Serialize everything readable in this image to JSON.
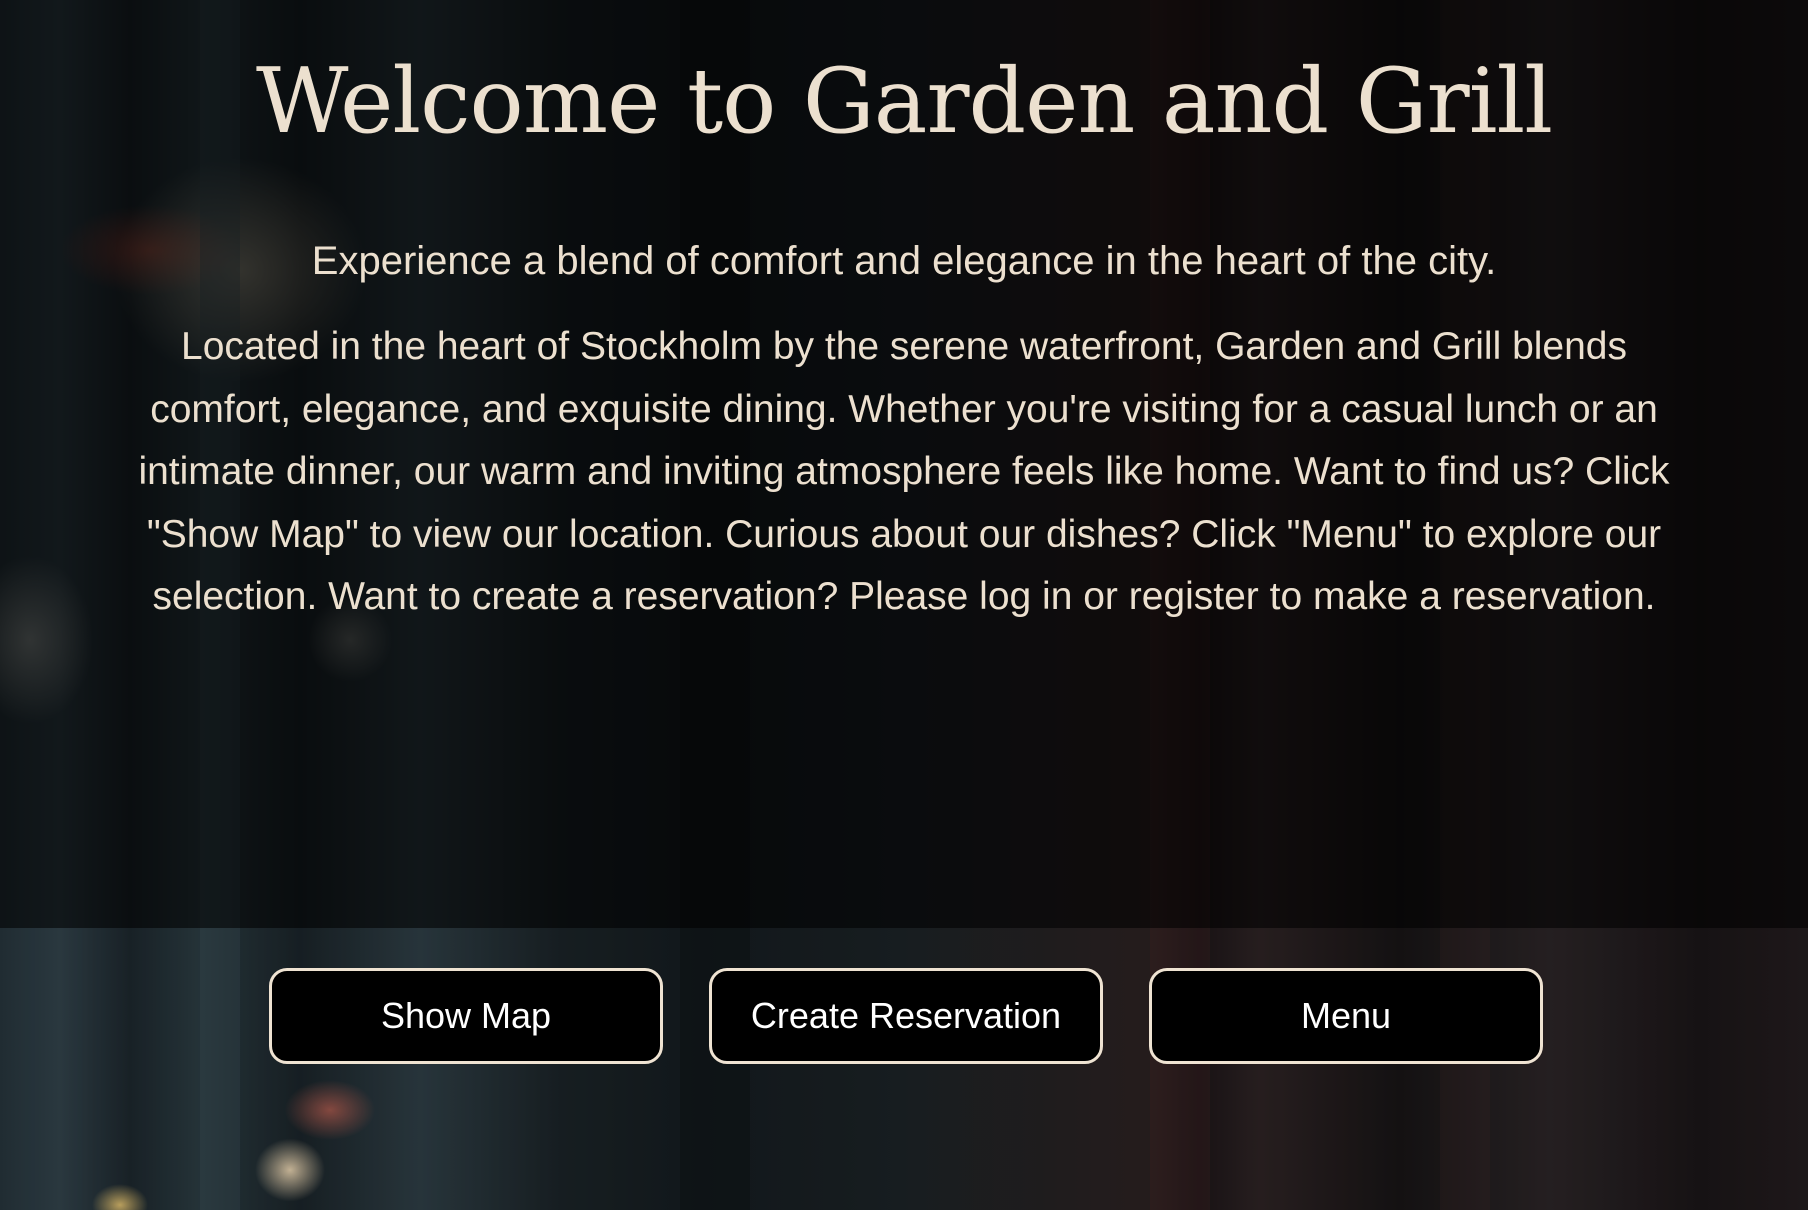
{
  "hero": {
    "title": "Welcome to Garden and Grill",
    "tagline": "Experience a blend of comfort and elegance in the heart of the city.",
    "description": "Located in the heart of Stockholm by the serene waterfront, Garden and Grill blends comfort, elegance, and exquisite dining. Whether you're visiting for a casual lunch or an intimate dinner, our warm and inviting atmosphere feels like home. Want to find us? Click \"Show Map\" to view our location. Curious about our dishes? Click \"Menu\" to explore our selection. Want to create a reservation? Please log in or register to make a reservation."
  },
  "actions": {
    "show_map_label": "Show Map",
    "create_reservation_label": "Create Reservation",
    "menu_label": "Menu"
  },
  "colors": {
    "text": "#ece0cf",
    "button_background": "#000000",
    "button_border": "#efe3d2",
    "button_text": "#ffffff"
  }
}
